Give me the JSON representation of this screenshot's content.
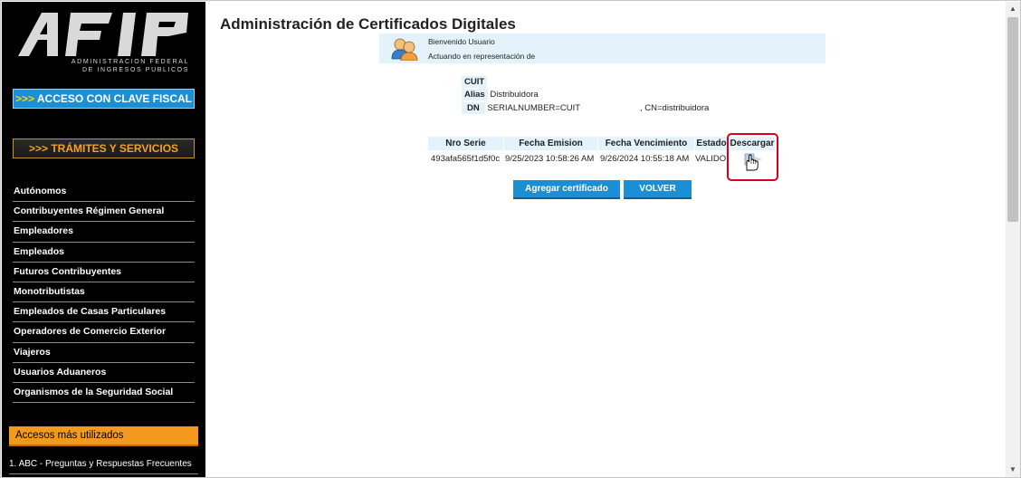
{
  "sidebar": {
    "logo_sub_line1": "ADMINISTRACION FEDERAL",
    "logo_sub_line2": "DE INGRESOS PUBLICOS",
    "clave_fiscal_arrows": ">>>",
    "clave_fiscal_label": "ACCESO CON CLAVE FISCAL",
    "tramites_label": ">>> TRÁMITES Y SERVICIOS",
    "items": [
      {
        "label": "Autónomos"
      },
      {
        "label": "Contribuyentes Régimen General"
      },
      {
        "label": "Empleadores"
      },
      {
        "label": "Empleados"
      },
      {
        "label": "Futuros Contribuyentes"
      },
      {
        "label": "Monotributistas"
      },
      {
        "label": "Empleados de Casas Particulares"
      },
      {
        "label": "Operadores de Comercio Exterior"
      },
      {
        "label": "Viajeros"
      },
      {
        "label": "Usuarios Aduaneros"
      },
      {
        "label": "Organismos de la Seguridad Social"
      }
    ],
    "accesos_title": "Accesos más utilizados",
    "abc_link": "1. ABC - Preguntas y Respuestas Frecuentes"
  },
  "main": {
    "title": "Administración de Certificados Digitales",
    "welcome_line1": "Bienvenido Usuario",
    "welcome_line2": "Actuando en representación de",
    "cuit_label": "CUIT",
    "alias_label": "Alias",
    "alias_value": "Distribuidora",
    "dn_label": "DN",
    "dn_value_left": "SERIALNUMBER=CUIT",
    "dn_value_right": ", CN=distribuidora",
    "table": {
      "headers": [
        "Nro Serie",
        "Fecha Emision",
        "Fecha Vencimiento",
        "Estado",
        "Descargar"
      ],
      "row": {
        "nro_serie": "493afa565f1d5f0c",
        "fecha_emision": "9/25/2023 10:58:26 AM",
        "fecha_vencimiento": "9/26/2024 10:55:18 AM",
        "estado": "VALIDO"
      }
    },
    "btn_agregar": "Agregar certificado",
    "btn_volver": "VOLVER"
  },
  "colors": {
    "accent_blue": "#1a8fd6",
    "light_blue_bg": "#e3f2fb",
    "orange": "#f39a1e",
    "highlight_red": "#d6001c"
  },
  "icons": {
    "avatar": "users-icon",
    "download": "download-icon",
    "cursor": "hand-cursor-icon"
  }
}
